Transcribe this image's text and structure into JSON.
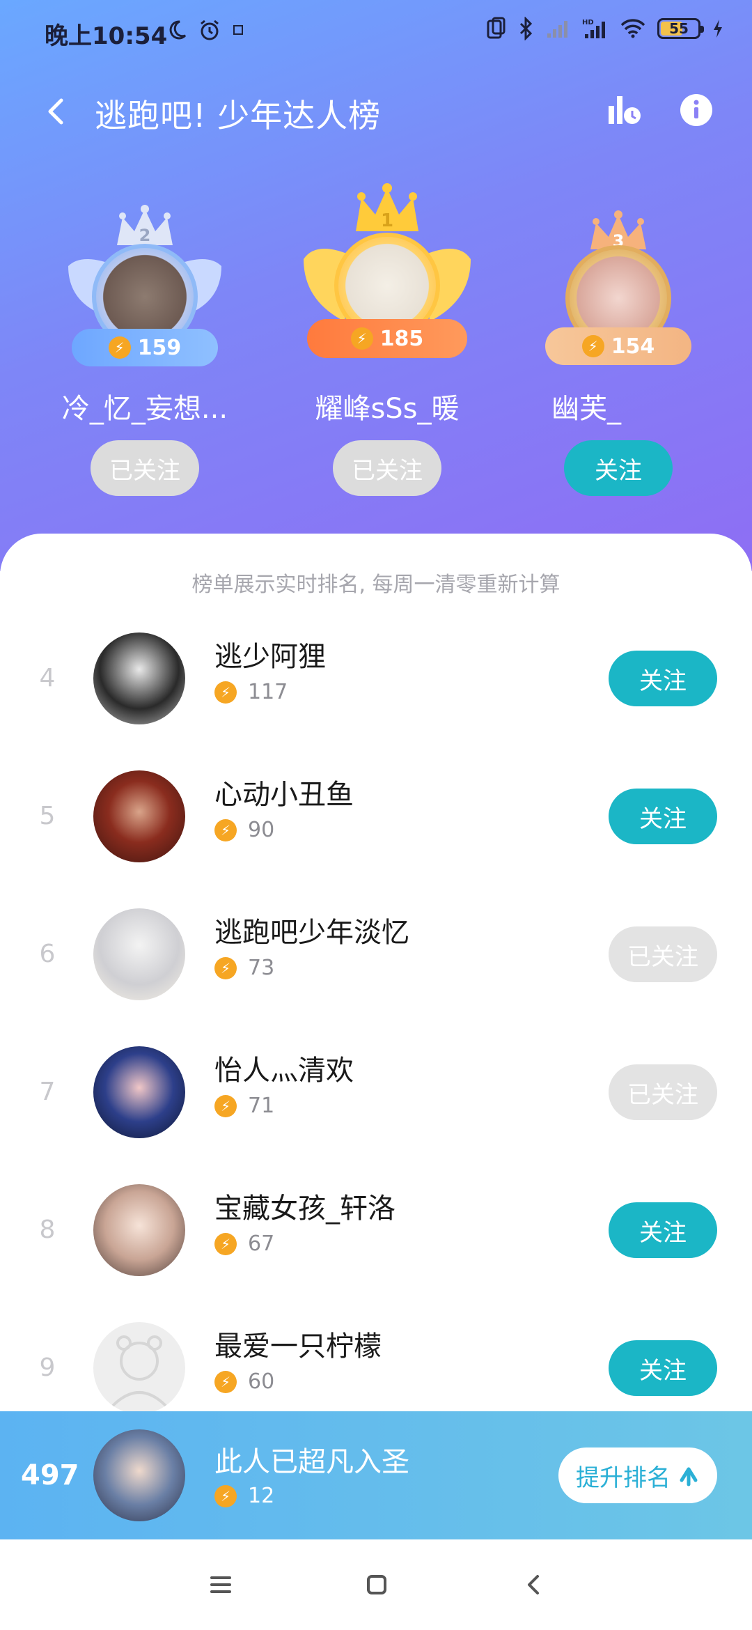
{
  "status_bar": {
    "time": "晚上10:54",
    "battery": "55"
  },
  "title_bar": {
    "title": "逃跑吧! 少年达人榜"
  },
  "podium": [
    {
      "rank": "2",
      "name": "冷_忆_妄想...",
      "score": "159",
      "button": "已关注",
      "followed": true
    },
    {
      "rank": "1",
      "name": "耀峰sSs_暖",
      "score": "185",
      "button": "已关注",
      "followed": true
    },
    {
      "rank": "3",
      "name": "幽芙_",
      "score": "154",
      "button": "关注",
      "followed": false
    }
  ],
  "notice": "榜单展示实时排名, 每周一清零重新计算",
  "list": [
    {
      "rank": "4",
      "name": "逃少阿狸",
      "score": "117",
      "button": "关注",
      "followed": false
    },
    {
      "rank": "5",
      "name": "心动小丑鱼",
      "score": "90",
      "button": "关注",
      "followed": false
    },
    {
      "rank": "6",
      "name": "逃跑吧少年淡忆",
      "score": "73",
      "button": "已关注",
      "followed": true
    },
    {
      "rank": "7",
      "name": "怡人灬清欢",
      "score": "71",
      "button": "已关注",
      "followed": true
    },
    {
      "rank": "8",
      "name": "宝藏女孩_轩洛",
      "score": "67",
      "button": "关注",
      "followed": false
    },
    {
      "rank": "9",
      "name": "最爱一只柠檬",
      "score": "60",
      "button": "关注",
      "followed": false
    }
  ],
  "my_rank": {
    "rank": "497",
    "name": "此人已超凡入圣",
    "score": "12",
    "button": "提升排名"
  },
  "colors": {
    "accent_teal": "#1bb6c6",
    "gold": "#f6a623",
    "hero_start": "#6aa8ff",
    "hero_end": "#8e6ef4"
  }
}
